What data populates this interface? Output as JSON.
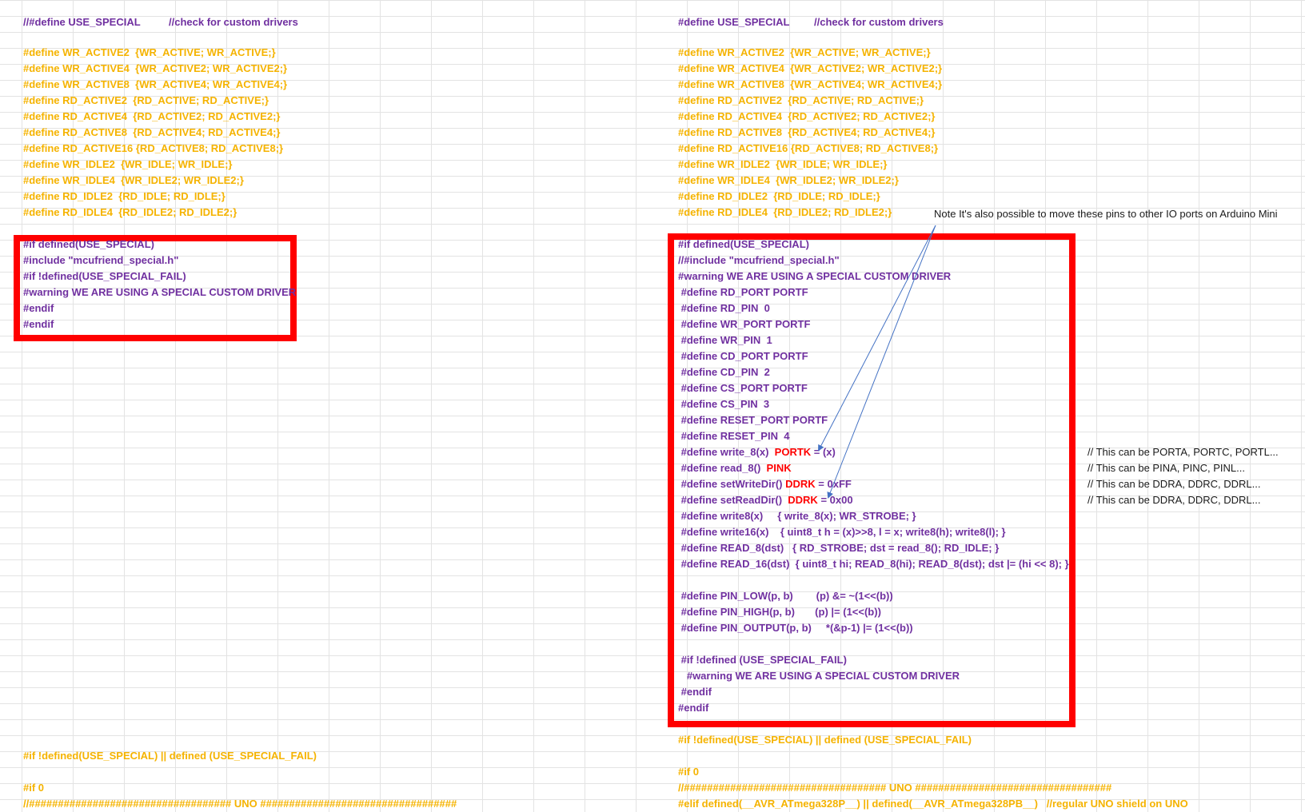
{
  "left": {
    "header_define": "//#define USE_SPECIAL",
    "header_comment": "//check for custom drivers",
    "defines": [
      "#define WR_ACTIVE2  {WR_ACTIVE; WR_ACTIVE;}",
      "#define WR_ACTIVE4  {WR_ACTIVE2; WR_ACTIVE2;}",
      "#define WR_ACTIVE8  {WR_ACTIVE4; WR_ACTIVE4;}",
      "#define RD_ACTIVE2  {RD_ACTIVE; RD_ACTIVE;}",
      "#define RD_ACTIVE4  {RD_ACTIVE2; RD_ACTIVE2;}",
      "#define RD_ACTIVE8  {RD_ACTIVE4; RD_ACTIVE4;}",
      "#define RD_ACTIVE16 {RD_ACTIVE8; RD_ACTIVE8;}",
      "#define WR_IDLE2  {WR_IDLE; WR_IDLE;}",
      "#define WR_IDLE4  {WR_IDLE2; WR_IDLE2;}",
      "#define RD_IDLE2  {RD_IDLE; RD_IDLE;}",
      "#define RD_IDLE4  {RD_IDLE2; RD_IDLE2;}"
    ],
    "special_block": [
      "#if defined(USE_SPECIAL)",
      "#include \"mcufriend_special.h\"",
      "#if !defined(USE_SPECIAL_FAIL)",
      "#warning WE ARE USING A SPECIAL CUSTOM DRIVER",
      "#endif",
      "#endif"
    ],
    "footer_if": "#if !defined(USE_SPECIAL) || defined (USE_SPECIAL_FAIL)",
    "footer_if0": "#if 0",
    "footer_uno": "//################################### UNO ##################################"
  },
  "right": {
    "header_define": "#define USE_SPECIAL",
    "header_comment": "//check for custom drivers",
    "defines": [
      "#define WR_ACTIVE2  {WR_ACTIVE; WR_ACTIVE;}",
      "#define WR_ACTIVE4  {WR_ACTIVE2; WR_ACTIVE2;}",
      "#define WR_ACTIVE8  {WR_ACTIVE4; WR_ACTIVE4;}",
      "#define RD_ACTIVE2  {RD_ACTIVE; RD_ACTIVE;}",
      "#define RD_ACTIVE4  {RD_ACTIVE2; RD_ACTIVE2;}",
      "#define RD_ACTIVE8  {RD_ACTIVE4; RD_ACTIVE4;}",
      "#define RD_ACTIVE16 {RD_ACTIVE8; RD_ACTIVE8;}",
      "#define WR_IDLE2  {WR_IDLE; WR_IDLE;}",
      "#define WR_IDLE4  {WR_IDLE2; WR_IDLE2;}",
      "#define RD_IDLE2  {RD_IDLE; RD_IDLE;}",
      "#define RD_IDLE4  {RD_IDLE2; RD_IDLE2;}"
    ],
    "note": "Note It's also possible to move these pins to other IO ports on Arduino Mini",
    "special_block": {
      "if_defined": "#if defined(USE_SPECIAL)",
      "include": "//#include \"mcufriend_special.h\"",
      "warning": "#warning WE ARE USING A SPECIAL CUSTOM DRIVER",
      "pins": [
        " #define RD_PORT PORTF",
        " #define RD_PIN  0",
        " #define WR_PORT PORTF",
        " #define WR_PIN  1",
        " #define CD_PORT PORTF",
        " #define CD_PIN  2",
        " #define CS_PORT PORTF",
        " #define CS_PIN  3",
        " #define RESET_PORT PORTF",
        " #define RESET_PIN  4"
      ],
      "write_8": {
        "pre": " #define write_8(x)  ",
        "red": "PORTK",
        "post": " = (x)"
      },
      "read_8": {
        "pre": " #define read_8()  ",
        "red": "PINK",
        "post": ""
      },
      "set_write_dir": {
        "pre": " #define setWriteDir() ",
        "red": "DDRK",
        "post": " = 0xFF"
      },
      "set_read_dir": {
        "pre": " #define setReadDir()  ",
        "red": "DDRK",
        "post": " = 0x00"
      },
      "macros": [
        " #define write8(x)     { write_8(x); WR_STROBE; }",
        " #define write16(x)    { uint8_t h = (x)>>8, l = x; write8(h); write8(l); }",
        " #define READ_8(dst)   { RD_STROBE; dst = read_8(); RD_IDLE; }",
        " #define READ_16(dst)  { uint8_t hi; READ_8(hi); READ_8(dst); dst |= (hi << 8); }"
      ],
      "pin_macros": [
        " #define PIN_LOW(p, b)        (p) &= ~(1<<(b))",
        " #define PIN_HIGH(p, b)       (p) |= (1<<(b))",
        " #define PIN_OUTPUT(p, b)     *(&p-1) |= (1<<(b))"
      ],
      "if_not_fail": " #if !defined (USE_SPECIAL_FAIL)",
      "warning2": "   #warning WE ARE USING A SPECIAL CUSTOM DRIVER",
      "endif_inner": " #endif",
      "endif_outer": "#endif"
    },
    "comments": [
      "// This can be PORTA, PORTC, PORTL...",
      "// This can be PINA, PINC, PINL...",
      "// This can be DDRA, DDRC, DDRL...",
      "// This can be DDRA, DDRC, DDRL..."
    ],
    "footer_if": "#if !defined(USE_SPECIAL) || defined (USE_SPECIAL_FAIL)",
    "footer_if0": "#if 0",
    "footer_uno": "//################################### UNO ##################################",
    "footer_elif": "#elif defined(__AVR_ATmega328P__) || defined(__AVR_ATmega328PB__)   //regular UNO shield on UNO"
  }
}
